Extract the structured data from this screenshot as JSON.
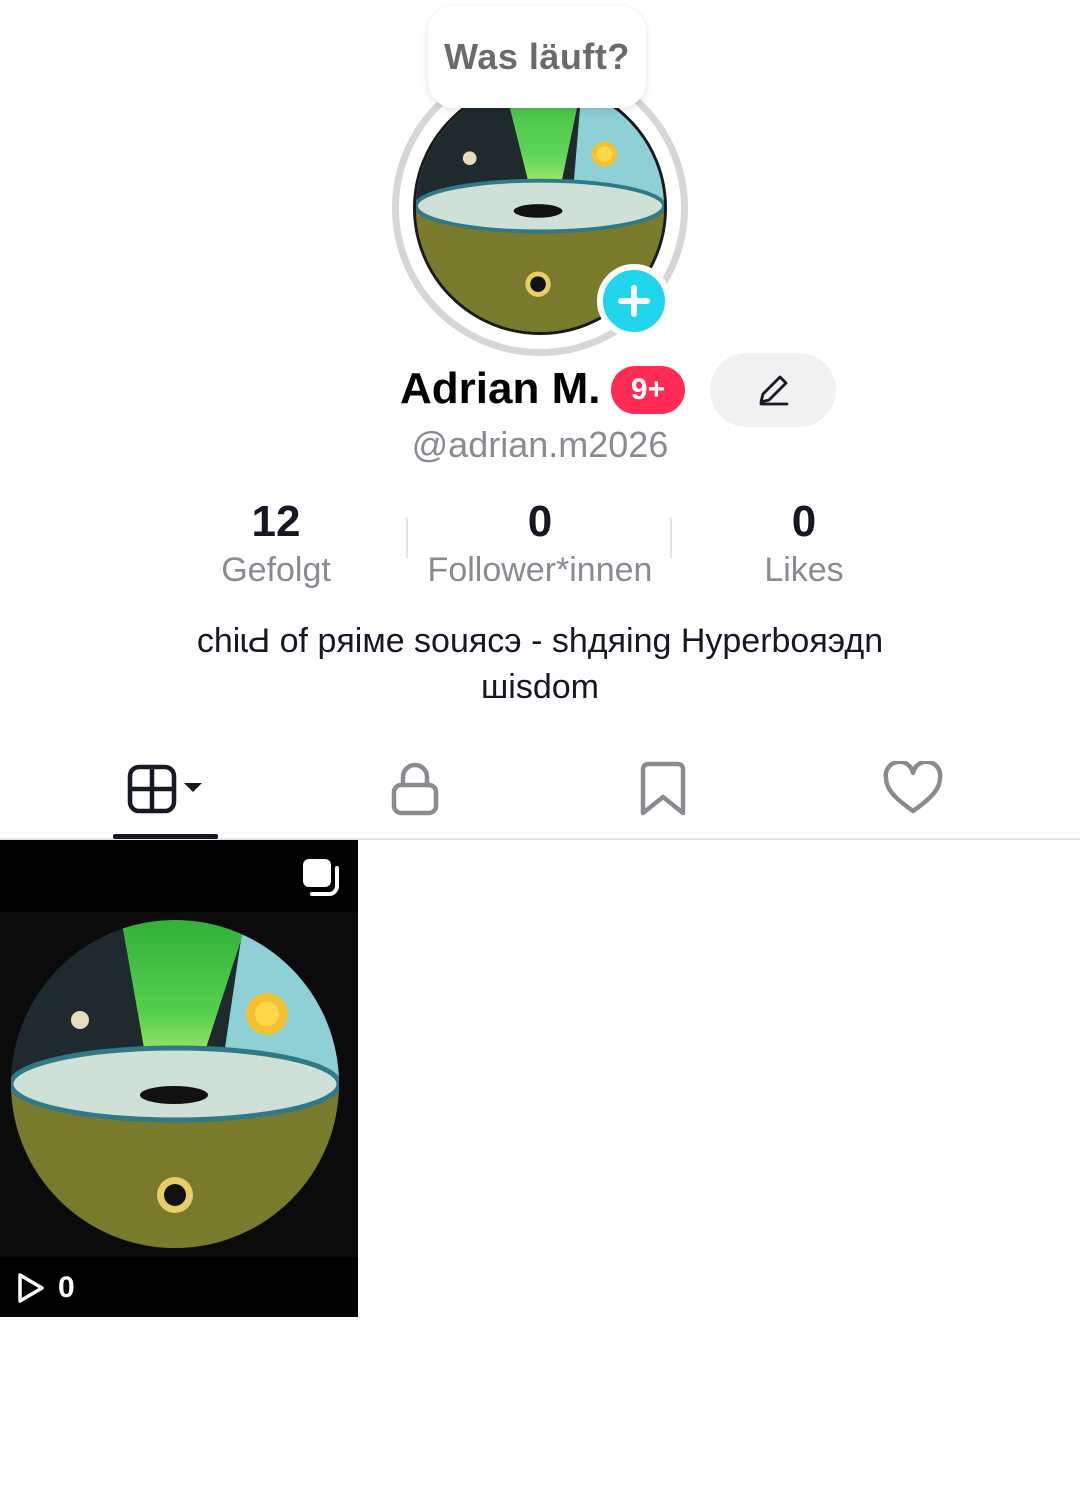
{
  "tooltip": {
    "text": "Was läuft?"
  },
  "profile": {
    "display_name": "Adrian M.",
    "notification_badge": "9+",
    "username": "@adrian.m2026",
    "bio": "chiɩԀ of pяiмe souяcэ - shдяing Hyperboяэдn шisdom"
  },
  "stats": [
    {
      "value": "12",
      "label": "Gefolgt"
    },
    {
      "value": "0",
      "label": "Follower*innen"
    },
    {
      "value": "0",
      "label": "Likes"
    }
  ],
  "tabs": [
    {
      "icon": "grid-icon",
      "selected": true
    },
    {
      "icon": "lock-icon",
      "selected": false
    },
    {
      "icon": "bookmark-icon",
      "selected": false
    },
    {
      "icon": "heart-icon",
      "selected": false
    }
  ],
  "videos": [
    {
      "views": "0",
      "icon": "multi-image-icon"
    }
  ],
  "colors": {
    "accent_plus": "#20d5ec",
    "badge_red": "#fe2c55",
    "secondary_text": "#8a8b91"
  }
}
